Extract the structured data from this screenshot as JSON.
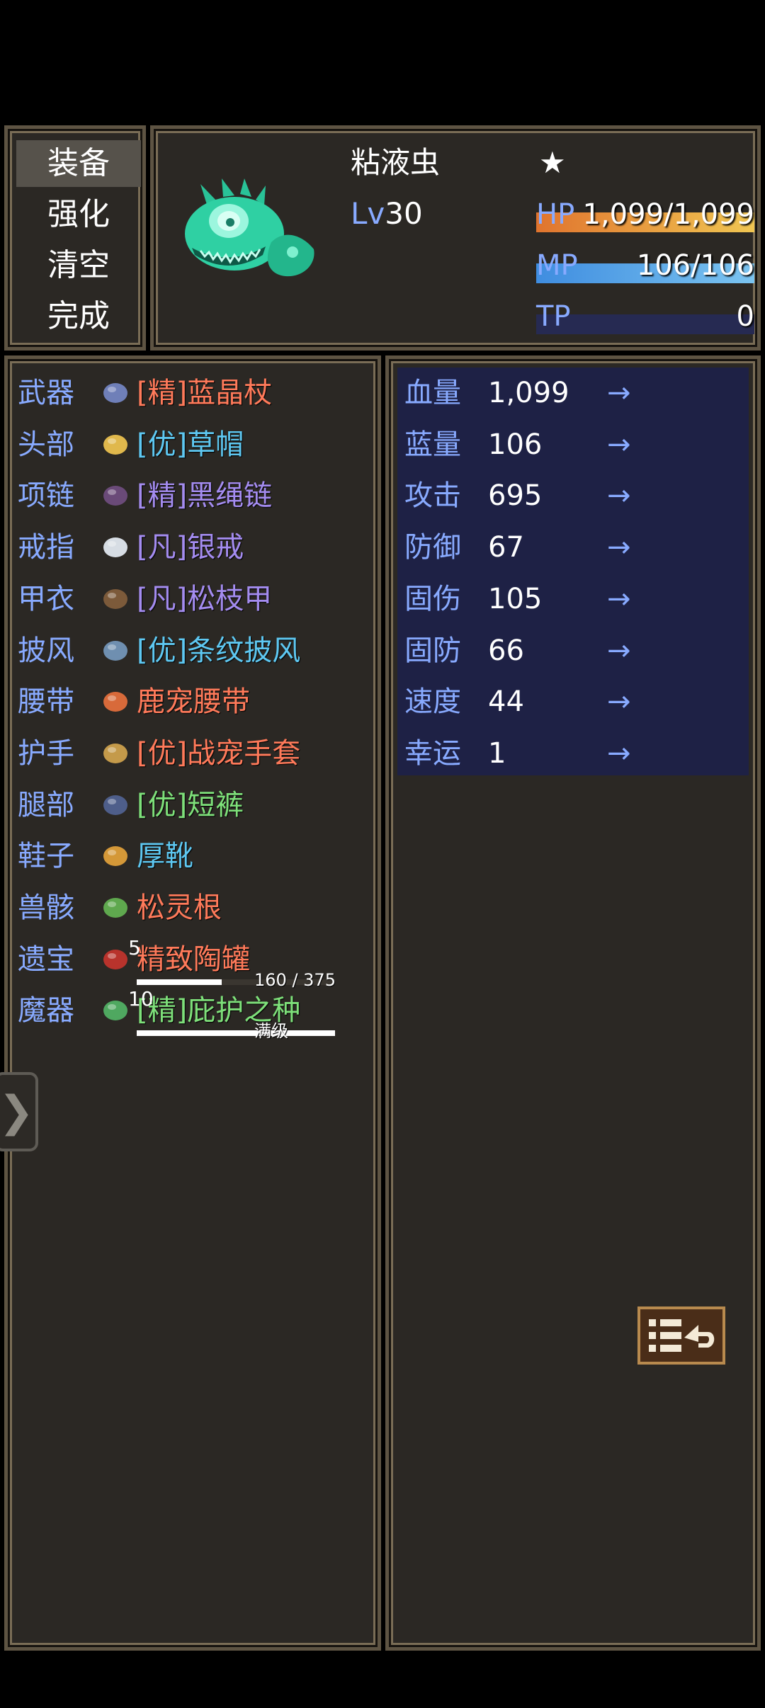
{
  "menu": {
    "items": [
      {
        "label": "装备"
      },
      {
        "label": "强化"
      },
      {
        "label": "清空"
      },
      {
        "label": "完成"
      }
    ]
  },
  "profile": {
    "name": "粘液虫",
    "star": "★",
    "level_prefix": "Lv",
    "level": "30",
    "hp": {
      "label": "HP",
      "text": "1,099/1,099",
      "fraction": 1.0
    },
    "mp": {
      "label": "MP",
      "text": "106/106",
      "fraction": 1.0
    },
    "tp": {
      "label": "TP",
      "text": "0",
      "fraction": 0.0
    }
  },
  "equipment": [
    {
      "slot": "武器",
      "item": "[精]蓝晶杖",
      "color": "#ff7a5a",
      "icon": "staff-icon"
    },
    {
      "slot": "头部",
      "item": "[优]草帽",
      "color": "#5ec8f2",
      "icon": "straw-hat-icon"
    },
    {
      "slot": "项链",
      "item": "[精]黑绳链",
      "color": "#a48cf0",
      "icon": "necklace-icon"
    },
    {
      "slot": "戒指",
      "item": "[凡]银戒",
      "color": "#a48cf0",
      "icon": "ring-icon"
    },
    {
      "slot": "甲衣",
      "item": "[凡]松枝甲",
      "color": "#a48cf0",
      "icon": "armor-icon"
    },
    {
      "slot": "披风",
      "item": "[优]条纹披风",
      "color": "#5ec8f2",
      "icon": "cape-icon"
    },
    {
      "slot": "腰带",
      "item": "鹿宠腰带",
      "color": "#ff7a5a",
      "icon": "belt-icon"
    },
    {
      "slot": "护手",
      "item": "[优]战宠手套",
      "color": "#ff7a5a",
      "icon": "gloves-icon"
    },
    {
      "slot": "腿部",
      "item": "[优]短裤",
      "color": "#7ee07a",
      "icon": "pants-icon"
    },
    {
      "slot": "鞋子",
      "item": "厚靴",
      "color": "#5ec8f2",
      "icon": "boots-icon"
    },
    {
      "slot": "兽骸",
      "item": "松灵根",
      "color": "#ff7a5a",
      "icon": "root-icon"
    },
    {
      "slot": "遗宝",
      "item": "精致陶罐",
      "color": "#ff7a5a",
      "icon": "pot-icon",
      "count": "5",
      "progress_text": "160 / 375",
      "progress": 0.427
    },
    {
      "slot": "魔器",
      "item": "[精]庇护之种",
      "color": "#7ee07a",
      "icon": "seed-icon",
      "count": "10",
      "progress_text": "满级",
      "progress": 1.0
    }
  ],
  "stats": [
    {
      "label": "血量",
      "value": "1,099",
      "arrow": "→"
    },
    {
      "label": "蓝量",
      "value": "106",
      "arrow": "→"
    },
    {
      "label": "攻击",
      "value": "695",
      "arrow": "→"
    },
    {
      "label": "防御",
      "value": "67",
      "arrow": "→"
    },
    {
      "label": "固伤",
      "value": "105",
      "arrow": "→"
    },
    {
      "label": "固防",
      "value": "66",
      "arrow": "→"
    },
    {
      "label": "速度",
      "value": "44",
      "arrow": "→"
    },
    {
      "label": "幸运",
      "value": "1",
      "arrow": "→"
    }
  ],
  "side_toggle": {
    "glyph": "❯"
  },
  "colors": {
    "slot_label": "#88aaff",
    "panel_bg": "#2b2824",
    "stats_bg": "#1e2145"
  }
}
